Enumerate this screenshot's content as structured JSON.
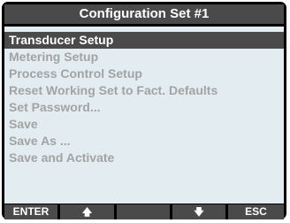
{
  "title": "Configuration Set #1",
  "menu": {
    "items": [
      {
        "label": "Transducer Setup",
        "selected": true
      },
      {
        "label": "Metering Setup",
        "selected": false
      },
      {
        "label": "Process Control Setup",
        "selected": false
      },
      {
        "label": "Reset Working Set to Fact. Defaults",
        "selected": false
      },
      {
        "label": "Set Password...",
        "selected": false
      },
      {
        "label": "Save",
        "selected": false
      },
      {
        "label": "Save As ...",
        "selected": false
      },
      {
        "label": "Save and Activate",
        "selected": false
      }
    ]
  },
  "softkeys": {
    "k1": "ENTER",
    "k2_icon": "arrow-up-icon",
    "k3": "",
    "k4_icon": "arrow-down-icon",
    "k5": "ESC"
  },
  "colors": {
    "frame": "#000000",
    "bar": "#4a4a4a",
    "screen": "#e3ecf0",
    "item_text": "#a3a3a3",
    "selected_text": "#ffffff"
  }
}
